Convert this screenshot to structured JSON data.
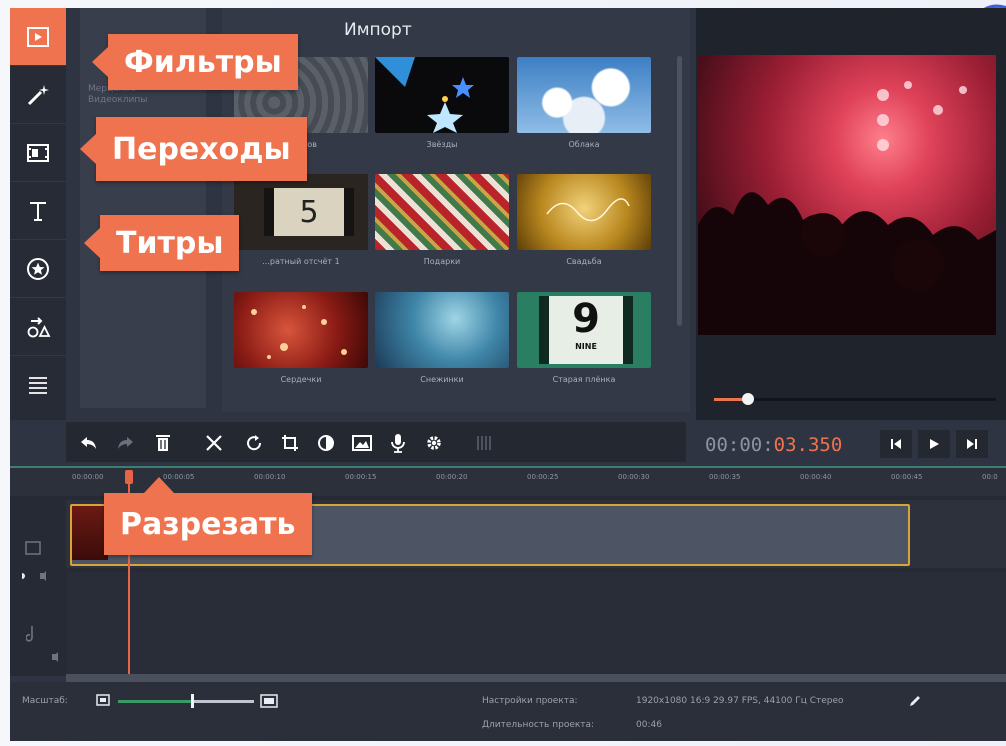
{
  "callouts": {
    "filters": "Фильтры",
    "transitions": "Переходы",
    "titles": "Титры",
    "cut": "Разрезать"
  },
  "library": {
    "title": "Импорт",
    "categories": [
      "Мерцание",
      "Видеоклипы"
    ],
    "thumbnails": [
      {
        "label": "...потов",
        "icon": "film-thumbnail"
      },
      {
        "label": "Звёзды",
        "icon": "stars-thumbnail"
      },
      {
        "label": "Облака",
        "icon": "clouds-thumbnail"
      },
      {
        "label": "...ратный отсчёт 1",
        "icon": "countdown-thumbnail",
        "digit": "5"
      },
      {
        "label": "Подарки",
        "icon": "gifts-thumbnail"
      },
      {
        "label": "Свадьба",
        "icon": "wedding-thumbnail"
      },
      {
        "label": "Сердечки",
        "icon": "hearts-thumbnail"
      },
      {
        "label": "Снежинки",
        "icon": "snowflakes-thumbnail"
      },
      {
        "label": "Старая плёнка",
        "icon": "old-film-thumbnail",
        "digit": "9",
        "caption": "NINE"
      }
    ]
  },
  "player": {
    "timecode_main": "00:00:",
    "timecode_highlight": "03.350",
    "seek_progress": 0.12
  },
  "timeline": {
    "ruler_ticks": [
      "00:00:00",
      "00:00:05",
      "00:00:10",
      "00:00:15",
      "00:00:20",
      "00:00:25",
      "00:00:30",
      "00:00:35",
      "00:00:40",
      "00:00:45",
      "00:0"
    ]
  },
  "status": {
    "zoom_label": "Масштаб:",
    "project_settings_label": "Настройки проекта:",
    "project_settings_value": "1920x1080 16:9 29.97 FPS, 44100 Гц Стерео",
    "duration_label": "Длительность проекта:",
    "duration_value": "00:46",
    "zoom_level": 0.55
  },
  "colors": {
    "accent": "#f0734f",
    "panel": "#2e3441",
    "sidebar": "#262b36",
    "clip_border": "#d8a437",
    "zoom_green": "#3a9a66"
  }
}
